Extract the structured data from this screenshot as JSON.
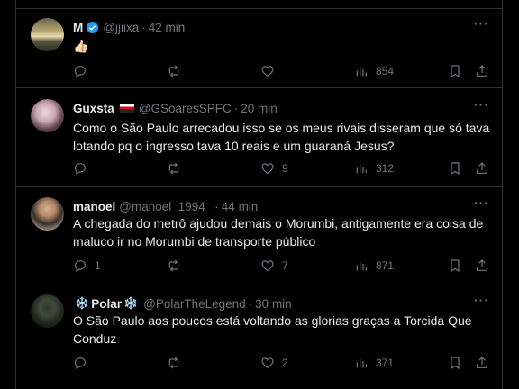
{
  "tweets": [
    {
      "name": "M",
      "handle": "@jjiixa",
      "time": "42 min",
      "verified": true,
      "text": "👍🏻",
      "replies": "",
      "reposts": "",
      "likes": "",
      "views": "854"
    },
    {
      "name": "Guxsta",
      "handle": "@GSoaresSPFC",
      "time": "20 min",
      "flag": "Saõ Paulo flag",
      "text": "Como o São Paulo arrecadou isso se os meus rivais disseram que só tava lotando pq o ingresso tava 10 reais e um guaraná Jesus?",
      "replies": "",
      "reposts": "",
      "likes": "9",
      "views": "312"
    },
    {
      "name": "manoel",
      "handle": "@manoel_1994_",
      "time": "44 min",
      "text": "A chegada do metrô ajudou demais o Morumbi, antigamente era coisa de maluco ir no Morumbi de transporte público",
      "replies": "1",
      "reposts": "",
      "likes": "7",
      "views": "871"
    },
    {
      "name": "Polar",
      "handle": "@PolarTheLegend",
      "time": "30 min",
      "name_prefix": "❄️",
      "name_suffix": "❄️",
      "text": "O São Paulo aos poucos está voltando as glorias graças a Torcida Que Conduz",
      "replies": "",
      "reposts": "",
      "likes": "2",
      "views": "371"
    }
  ],
  "icons": {
    "reply": "reply-icon",
    "repost": "repost-icon",
    "like": "like-icon",
    "views": "views-icon",
    "bookmark": "bookmark-icon",
    "share": "share-icon",
    "more": "more-icon"
  },
  "colors": {
    "background": "#000000",
    "text": "#e7e9ea",
    "muted": "#71767b",
    "border": "#2f3336",
    "verified": "#1d9bf0"
  }
}
